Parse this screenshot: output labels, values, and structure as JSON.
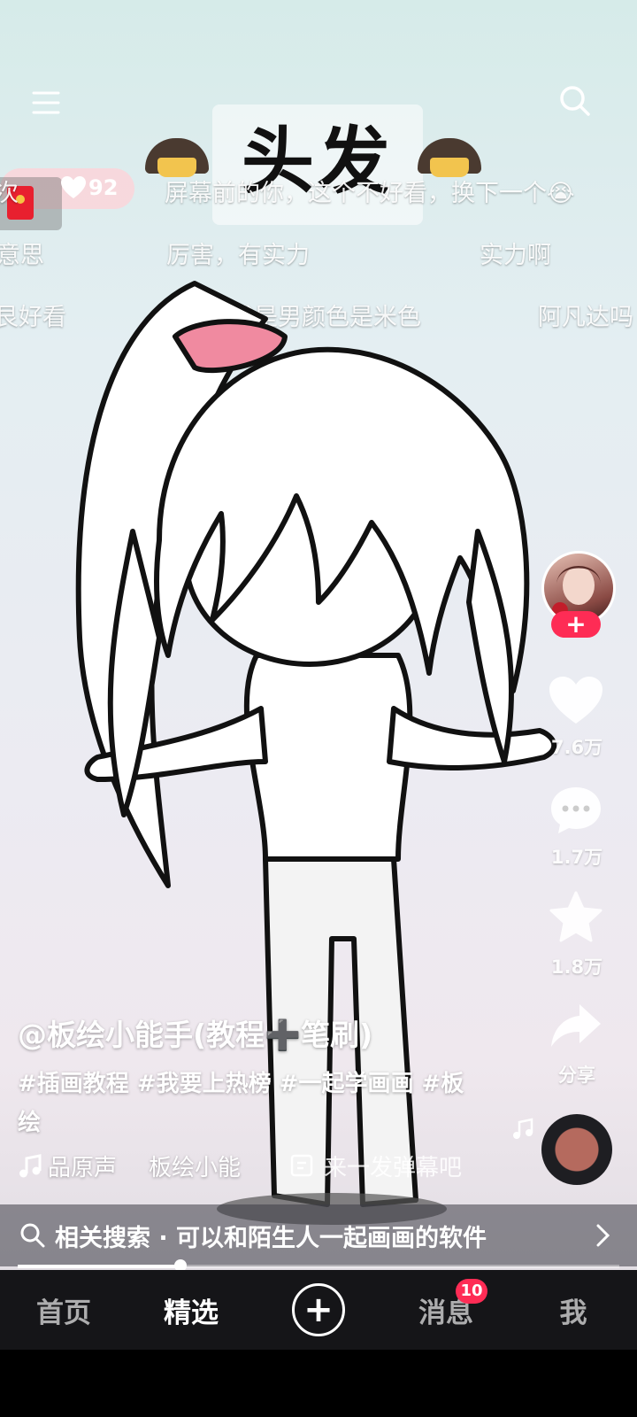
{
  "header": {
    "menu_icon": "menu-icon",
    "search_icon": "search-icon",
    "video_title": "头发"
  },
  "like_pill": {
    "count": "92"
  },
  "danmaku": [
    {
      "text": "屏幕前的你，这个不好看，换下一个😭"
    },
    {
      "text": "次"
    },
    {
      "text": "意思"
    },
    {
      "text": "厉害，有实力"
    },
    {
      "text": "实力啊"
    },
    {
      "text": "艮好看"
    },
    {
      "text": "我是男颜色是米色"
    },
    {
      "text": "阿凡达吗"
    }
  ],
  "side_actions": {
    "likes": "7.6万",
    "comments": "1.7万",
    "favorites": "1.8万",
    "share": "分享"
  },
  "video": {
    "author": "@板绘小能手(教程➕笔刷)",
    "description": "#插画教程 #我要上热榜 #一起学画画 #板绘",
    "music": "品原声",
    "music_author": "板绘小能",
    "danmaku_prompt": "来一发弹幕吧",
    "progress": 0.27
  },
  "related_search": {
    "label": "相关搜索 · 可以和陌生人一起画画的软件"
  },
  "tabbar": {
    "home": "首页",
    "featured": "精选",
    "messages": "消息",
    "messages_badge": "10",
    "me": "我"
  },
  "colors": {
    "accent": "#fe2c55",
    "tabbar_bg": "#151518"
  }
}
